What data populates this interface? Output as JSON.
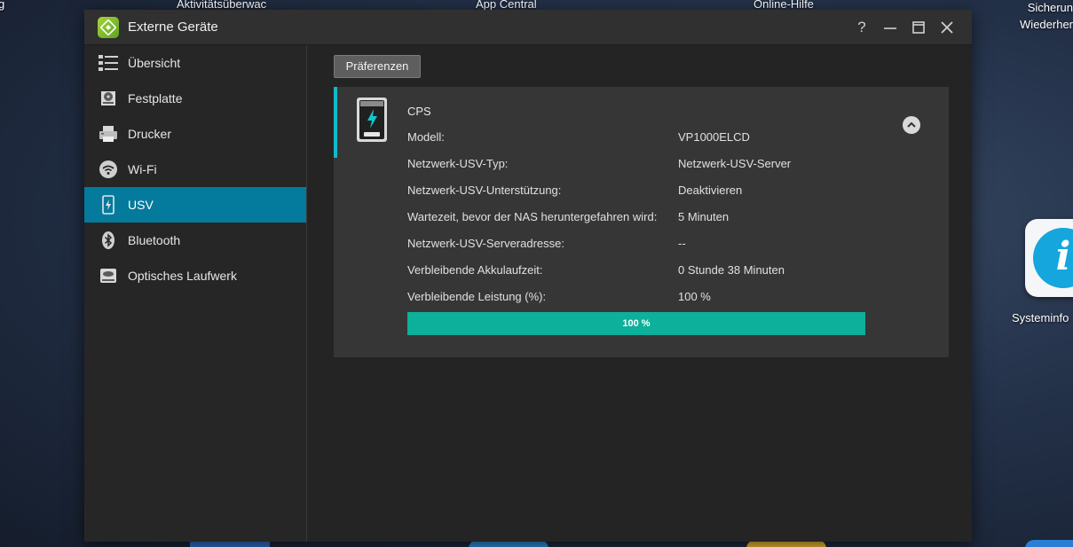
{
  "desktop": {
    "top_labels": [
      "Aktivitätsüberwac",
      "App Central",
      "Online-Hilfe"
    ],
    "right_labels": [
      "Sicherun",
      "Wiederher"
    ],
    "icon_label": "Systeminfo",
    "left_edge_label": "g"
  },
  "window": {
    "title": "Externe Geräte",
    "controls": {
      "help": "?"
    }
  },
  "sidebar": {
    "items": [
      {
        "label": "Übersicht",
        "icon": "overview-icon"
      },
      {
        "label": "Festplatte",
        "icon": "hard-disk-icon"
      },
      {
        "label": "Drucker",
        "icon": "printer-icon"
      },
      {
        "label": "Wi-Fi",
        "icon": "wifi-icon"
      },
      {
        "label": "USV",
        "icon": "ups-icon",
        "active": true
      },
      {
        "label": "Bluetooth",
        "icon": "bluetooth-icon"
      },
      {
        "label": "Optisches Laufwerk",
        "icon": "optical-drive-icon"
      }
    ]
  },
  "main": {
    "preferences_label": "Präferenzen",
    "device": {
      "name": "CPS",
      "rows": [
        {
          "label": "Modell:",
          "value": "VP1000ELCD"
        },
        {
          "label": "Netzwerk-USV-Typ:",
          "value": "Netzwerk-USV-Server"
        },
        {
          "label": "Netzwerk-USV-Unterstützung:",
          "value": "Deaktivieren"
        },
        {
          "label": "Wartezeit, bevor der NAS heruntergefahren wird:",
          "value": "5 Minuten"
        },
        {
          "label": "Netzwerk-USV-Serveradresse:",
          "value": "--"
        },
        {
          "label": "Verbleibende Akkulaufzeit:",
          "value": "0 Stunde 38 Minuten"
        },
        {
          "label": "Verbleibende Leistung (%):",
          "value": "100 %"
        }
      ],
      "power_percent": 100,
      "power_label": "100 %"
    }
  },
  "colors": {
    "active_nav": "#047a9c",
    "accent_bar": "#10b8c9",
    "progress_fill": "#0db09a"
  }
}
